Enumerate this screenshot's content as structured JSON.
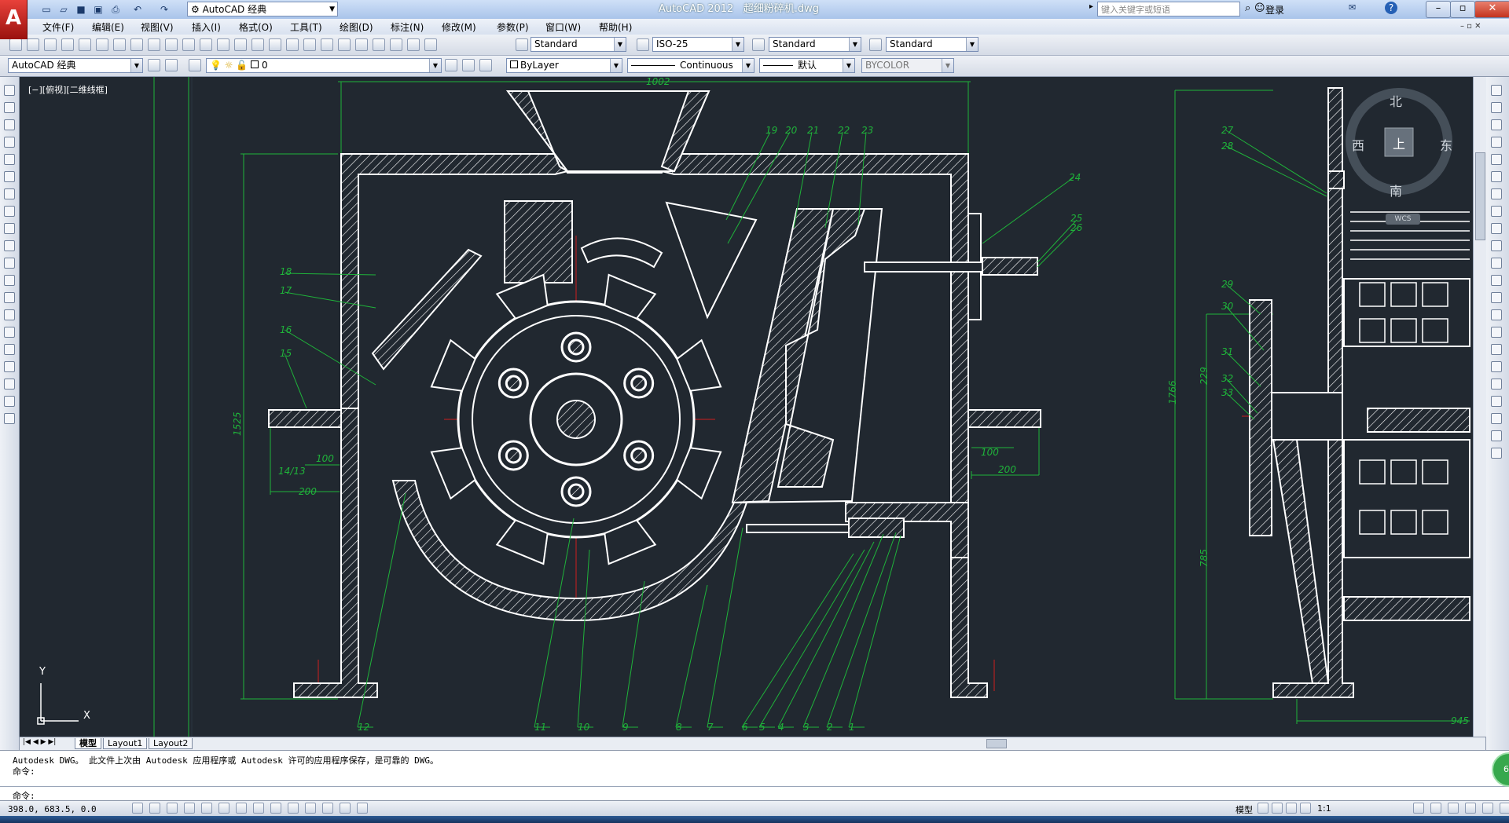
{
  "app": {
    "title": "AutoCAD 2012",
    "document": "超细粉碎机.dwg",
    "workspace": "AutoCAD 经典",
    "search_placeholder": "键入关键字或短语",
    "login": "登录",
    "logo": "A"
  },
  "menu": [
    "文件(F)",
    "编辑(E)",
    "视图(V)",
    "插入(I)",
    "格式(O)",
    "工具(T)",
    "绘图(D)",
    "标注(N)",
    "修改(M)",
    "参数(P)",
    "窗口(W)",
    "帮助(H)"
  ],
  "styles": {
    "text_style": "Standard",
    "dim_style": "ISO-25",
    "table_style": "Standard",
    "multileader_style": "Standard"
  },
  "layers": {
    "workspace": "AutoCAD 经典",
    "current_layer": "0",
    "color": "ByLayer",
    "linetype": "Continuous",
    "lineweight": "默认",
    "plotstyle": "BYCOLOR"
  },
  "viewport": {
    "label": "[−][俯视][二维线框]"
  },
  "viewcube": {
    "north": "北",
    "south": "南",
    "west": "西",
    "east": "东",
    "top": "上",
    "wcs": "WCS"
  },
  "ucs": {
    "x": "X",
    "y": "Y"
  },
  "drawing": {
    "balloons_bottom": [
      "12",
      "11",
      "10",
      "9",
      "8",
      "7",
      "6",
      "5",
      "4",
      "3",
      "2",
      "1"
    ],
    "balloons_top": [
      "19",
      "20",
      "21",
      "22",
      "23",
      "24",
      "25",
      "26"
    ],
    "balloons_left": [
      "18",
      "17",
      "16",
      "15",
      "14/13"
    ],
    "balloons_side": [
      "27",
      "28",
      "29",
      "30",
      "31",
      "32",
      "33"
    ],
    "dims": {
      "height_front": "1525",
      "left_100": "100",
      "left_200": "200",
      "right_100": "100",
      "right_200": "200",
      "height_side": "1766",
      "side_229": "229",
      "side_785": "785",
      "side_945": "945",
      "top_width": "1002"
    }
  },
  "layout_tabs": [
    "模型",
    "Layout1",
    "Layout2"
  ],
  "command": {
    "history_1": "Autodesk DWG。  此文件上次由 Autodesk 应用程序或 Autodesk 许可的应用程序保存，是可靠的 DWG。",
    "history_2": "命令:",
    "prompt": "命令:"
  },
  "status": {
    "coords": "398.0, 683.5, 0.0",
    "model": "模型",
    "scale": "1:1"
  },
  "badge": "68"
}
